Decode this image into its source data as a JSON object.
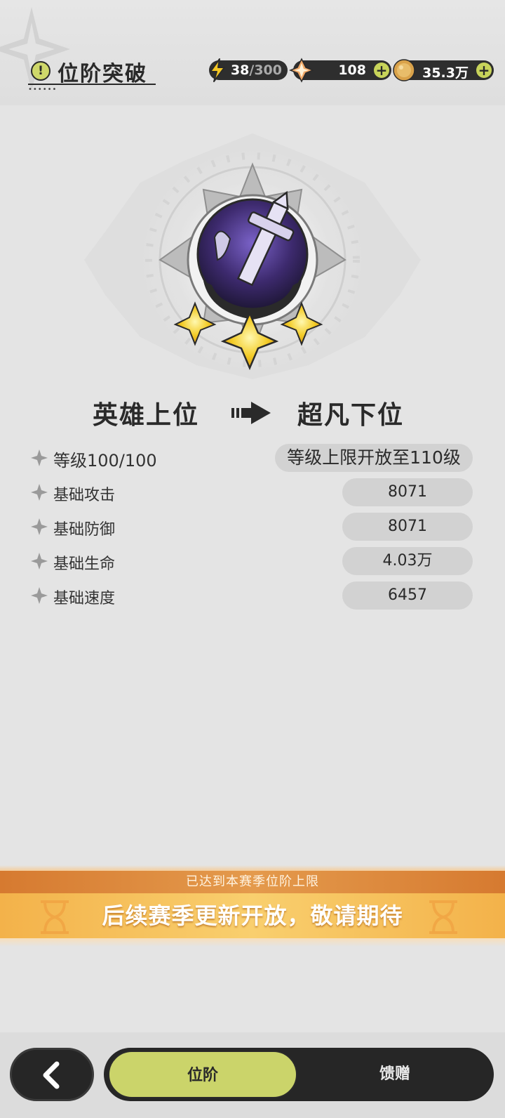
{
  "header": {
    "title": "位阶突破",
    "title_icon": "info-exclamation-icon",
    "resources": {
      "energy": {
        "icon": "lightning-icon",
        "current": "38",
        "max": "/300"
      },
      "gem": {
        "icon": "diamond-gem-icon",
        "value": "108",
        "plus": "+"
      },
      "coin": {
        "icon": "gold-coin-icon",
        "value": "35.3万",
        "plus": "+"
      }
    }
  },
  "emblem": {
    "icon": "sword-rank-emblem",
    "stars": 3
  },
  "rank": {
    "from": "英雄上位",
    "to": "超凡下位",
    "arrow_icon": "arrow-right-icon"
  },
  "stats": [
    {
      "label": "等级100/100",
      "value": "等级上限开放至110级"
    },
    {
      "label": "基础攻击",
      "value": "8071"
    },
    {
      "label": "基础防御",
      "value": "8071"
    },
    {
      "label": "基础生命",
      "value": "4.03万"
    },
    {
      "label": "基础速度",
      "value": "6457"
    }
  ],
  "banner": {
    "subtitle": "已达到本赛季位阶上限",
    "message": "后续赛季更新开放，敬请期待"
  },
  "bottom": {
    "back_icon": "chevron-left-icon",
    "tabs": [
      {
        "label": "位阶",
        "active": true
      },
      {
        "label": "馈赠",
        "active": false
      }
    ]
  },
  "colors": {
    "accent": "#cbd46a",
    "dark": "#262626",
    "banner_orange": "#f3b24a",
    "background": "#e4e4e4"
  }
}
